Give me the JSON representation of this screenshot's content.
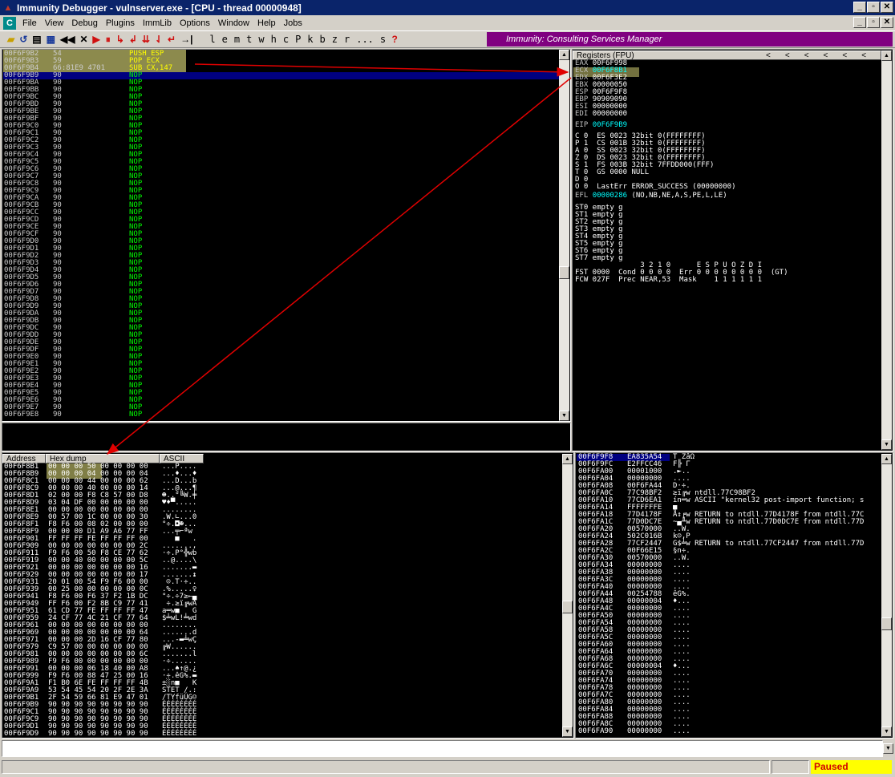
{
  "window": {
    "title": "Immunity Debugger - vulnserver.exe - [CPU - thread 00000948]",
    "min": "_",
    "restore": "▫",
    "close": "✕"
  },
  "menu": [
    "File",
    "View",
    "Debug",
    "Plugins",
    "ImmLib",
    "Options",
    "Window",
    "Help",
    "Jobs"
  ],
  "toolbar": {
    "buttons": [
      "◀◀",
      "✕",
      "▶",
      "⏸",
      "↳",
      "↲",
      "⇊",
      "⇃",
      "↵",
      "→|"
    ],
    "letters": [
      "l",
      "e",
      "m",
      "t",
      "w",
      "h",
      "c",
      "P",
      "k",
      "b",
      "z",
      "r",
      "...",
      "s",
      "?"
    ],
    "banner": "Immunity: Consulting Services Manager"
  },
  "disasm": [
    {
      "addr": "00F6F9B2",
      "hex": "54",
      "ins": "PUSH ESP"
    },
    {
      "addr": "00F6F9B3",
      "hex": "59",
      "ins": "POP ECX"
    },
    {
      "addr": "00F6F9B4",
      "hex": "66:81E9 4701",
      "ins": "SUB CX,147"
    },
    {
      "addr": "00F6F9B9",
      "hex": "90",
      "ins": "NOP"
    },
    {
      "addr": "00F6F9BA",
      "hex": "90",
      "ins": "NOP"
    },
    {
      "addr": "00F6F9BB",
      "hex": "90",
      "ins": "NOP"
    },
    {
      "addr": "00F6F9BC",
      "hex": "90",
      "ins": "NOP"
    },
    {
      "addr": "00F6F9BD",
      "hex": "90",
      "ins": "NOP"
    },
    {
      "addr": "00F6F9BE",
      "hex": "90",
      "ins": "NOP"
    },
    {
      "addr": "00F6F9BF",
      "hex": "90",
      "ins": "NOP"
    },
    {
      "addr": "00F6F9C0",
      "hex": "90",
      "ins": "NOP"
    },
    {
      "addr": "00F6F9C1",
      "hex": "90",
      "ins": "NOP"
    },
    {
      "addr": "00F6F9C2",
      "hex": "90",
      "ins": "NOP"
    },
    {
      "addr": "00F6F9C3",
      "hex": "90",
      "ins": "NOP"
    },
    {
      "addr": "00F6F9C4",
      "hex": "90",
      "ins": "NOP"
    },
    {
      "addr": "00F6F9C5",
      "hex": "90",
      "ins": "NOP"
    },
    {
      "addr": "00F6F9C6",
      "hex": "90",
      "ins": "NOP"
    },
    {
      "addr": "00F6F9C7",
      "hex": "90",
      "ins": "NOP"
    },
    {
      "addr": "00F6F9C8",
      "hex": "90",
      "ins": "NOP"
    },
    {
      "addr": "00F6F9C9",
      "hex": "90",
      "ins": "NOP"
    },
    {
      "addr": "00F6F9CA",
      "hex": "90",
      "ins": "NOP"
    },
    {
      "addr": "00F6F9CB",
      "hex": "90",
      "ins": "NOP"
    },
    {
      "addr": "00F6F9CC",
      "hex": "90",
      "ins": "NOP"
    },
    {
      "addr": "00F6F9CD",
      "hex": "90",
      "ins": "NOP"
    },
    {
      "addr": "00F6F9CE",
      "hex": "90",
      "ins": "NOP"
    },
    {
      "addr": "00F6F9CF",
      "hex": "90",
      "ins": "NOP"
    },
    {
      "addr": "00F6F9D0",
      "hex": "90",
      "ins": "NOP"
    },
    {
      "addr": "00F6F9D1",
      "hex": "90",
      "ins": "NOP"
    },
    {
      "addr": "00F6F9D2",
      "hex": "90",
      "ins": "NOP"
    },
    {
      "addr": "00F6F9D3",
      "hex": "90",
      "ins": "NOP"
    },
    {
      "addr": "00F6F9D4",
      "hex": "90",
      "ins": "NOP"
    },
    {
      "addr": "00F6F9D5",
      "hex": "90",
      "ins": "NOP"
    },
    {
      "addr": "00F6F9D6",
      "hex": "90",
      "ins": "NOP"
    },
    {
      "addr": "00F6F9D7",
      "hex": "90",
      "ins": "NOP"
    },
    {
      "addr": "00F6F9D8",
      "hex": "90",
      "ins": "NOP"
    },
    {
      "addr": "00F6F9D9",
      "hex": "90",
      "ins": "NOP"
    },
    {
      "addr": "00F6F9DA",
      "hex": "90",
      "ins": "NOP"
    },
    {
      "addr": "00F6F9DB",
      "hex": "90",
      "ins": "NOP"
    },
    {
      "addr": "00F6F9DC",
      "hex": "90",
      "ins": "NOP"
    },
    {
      "addr": "00F6F9DD",
      "hex": "90",
      "ins": "NOP"
    },
    {
      "addr": "00F6F9DE",
      "hex": "90",
      "ins": "NOP"
    },
    {
      "addr": "00F6F9DF",
      "hex": "90",
      "ins": "NOP"
    },
    {
      "addr": "00F6F9E0",
      "hex": "90",
      "ins": "NOP"
    },
    {
      "addr": "00F6F9E1",
      "hex": "90",
      "ins": "NOP"
    },
    {
      "addr": "00F6F9E2",
      "hex": "90",
      "ins": "NOP"
    },
    {
      "addr": "00F6F9E3",
      "hex": "90",
      "ins": "NOP"
    },
    {
      "addr": "00F6F9E4",
      "hex": "90",
      "ins": "NOP"
    },
    {
      "addr": "00F6F9E5",
      "hex": "90",
      "ins": "NOP"
    },
    {
      "addr": "00F6F9E6",
      "hex": "90",
      "ins": "NOP"
    },
    {
      "addr": "00F6F9E7",
      "hex": "90",
      "ins": "NOP"
    },
    {
      "addr": "00F6F9E8",
      "hex": "90",
      "ins": "NOP"
    }
  ],
  "registers": {
    "header": "Registers (FPU)",
    "gp": [
      {
        "name": "EAX",
        "val": "00F6F998"
      },
      {
        "name": "ECX",
        "val": "00F6F8B1"
      },
      {
        "name": "EDX",
        "val": "00F6F3E2"
      },
      {
        "name": "EBX",
        "val": "00000050"
      },
      {
        "name": "ESP",
        "val": "00F6F9F8"
      },
      {
        "name": "EBP",
        "val": "90909090"
      },
      {
        "name": "ESI",
        "val": "00000000"
      },
      {
        "name": "EDI",
        "val": "00000000"
      }
    ],
    "eip": {
      "name": "EIP",
      "val": "00F6F9B9"
    },
    "flags": [
      "C 0  ES 0023 32bit 0(FFFFFFFF)",
      "P 1  CS 001B 32bit 0(FFFFFFFF)",
      "A 0  SS 0023 32bit 0(FFFFFFFF)",
      "Z 0  DS 0023 32bit 0(FFFFFFFF)",
      "S 1  FS 003B 32bit 7FFDD000(FFF)",
      "T 0  GS 0000 NULL",
      "D 0",
      "O 0  LastErr ERROR_SUCCESS (00000000)"
    ],
    "efl": {
      "name": "EFL",
      "val": "00000286",
      "desc": "(NO,NB,NE,A,S,PE,L,LE)"
    },
    "fpu": [
      "ST0 empty g",
      "ST1 empty g",
      "ST2 empty g",
      "ST3 empty g",
      "ST4 empty g",
      "ST5 empty g",
      "ST6 empty g",
      "ST7 empty g"
    ],
    "fst_hdr": "               3 2 1 0      E S P U O Z D I",
    "fst": "FST 0000  Cond 0 0 0 0  Err 0 0 0 0 0 0 0 0  (GT)",
    "fcw": "FCW 027F  Prec NEAR,53  Mask    1 1 1 1 1 1",
    "nav_arrows": [
      "<",
      "<",
      "<",
      "<",
      "<",
      "<",
      "<",
      "<",
      "<"
    ]
  },
  "dump": {
    "col_address": "Address",
    "col_hex": "Hex dump",
    "col_ascii": "ASCII",
    "rows": [
      {
        "a": "00F6F8B1",
        "h": "00 00 00 50 00 00 00 00",
        "s": "...P...."
      },
      {
        "a": "00F6F8B9",
        "h": "00 00 00 04 00 00 00 04",
        "s": "...♦...♦"
      },
      {
        "a": "00F6F8C1",
        "h": "00 00 00 44 00 00 00 62",
        "s": "...D...b"
      },
      {
        "a": "00F6F8C9",
        "h": "00 00 00 40 00 00 00 14",
        "s": "...@...¶"
      },
      {
        "a": "00F6F8D1",
        "h": "02 00 00 F8 C8 57 00 D8",
        "s": "☻..°╚W.╪"
      },
      {
        "a": "00F6F8D9",
        "h": "03 04 DF 00 00 00 00 00",
        "s": "♥♦▀....."
      },
      {
        "a": "00F6F8E1",
        "h": "00 00 00 00 00 00 00 00",
        "s": "........"
      },
      {
        "a": "00F6F8E9",
        "h": "00 57 00 1C 00 00 00 30",
        "s": ".W.∟...0"
      },
      {
        "a": "00F6F8F1",
        "h": "F8 F6 00 08 02 00 00 00",
        "s": "°÷.◘☻..."
      },
      {
        "a": "00F6F8F9",
        "h": "00 00 00 D1 A9 A6 77 FF",
        "s": "...╤⌐ªw "
      },
      {
        "a": "00F6F901",
        "h": "FF FF FF FE FF FF FF 00",
        "s": "   ■   ."
      },
      {
        "a": "00F6F909",
        "h": "00 00 00 00 00 00 00 2C",
        "s": ".......,"
      },
      {
        "a": "00F6F911",
        "h": "F9 F6 00 50 F8 CE 77 62",
        "s": "·÷.P°╬wb"
      },
      {
        "a": "00F6F919",
        "h": "00 00 40 00 00 00 00 5C",
        "s": "..@....\\"
      },
      {
        "a": "00F6F921",
        "h": "00 00 00 00 00 00 00 16",
        "s": ".......▬"
      },
      {
        "a": "00F6F929",
        "h": "00 00 00 00 00 00 00 17",
        "s": ".......↨"
      },
      {
        "a": "00F6F931",
        "h": "20 01 00 54 F9 F6 00 00",
        "s": " ☺.T·÷.."
      },
      {
        "a": "00F6F939",
        "h": "00 25 00 00 00 00 00 0C",
        "s": ".%.....♀"
      },
      {
        "a": "00F6F941",
        "h": "F8 F6 00 F6 37 F2 1B DC",
        "s": "°÷.÷7≥←▄"
      },
      {
        "a": "00F6F949",
        "h": "FF F6 00 F2 8B C9 77 41",
        "s": " ÷.≥ï╔wA"
      },
      {
        "a": "00F6F951",
        "h": "61 CD 77 FE FF FF FF 47",
        "s": "a═w■   G"
      },
      {
        "a": "00F6F959",
        "h": "24 CF 77 4C 21 CF 77 64",
        "s": "$╧wL!╧wd"
      },
      {
        "a": "00F6F961",
        "h": "00 00 00 00 00 00 00 00",
        "s": "........"
      },
      {
        "a": "00F6F969",
        "h": "00 00 00 00 00 00 00 64",
        "s": ".......d"
      },
      {
        "a": "00F6F971",
        "h": "00 00 00 2D 16 CF 77 80",
        "s": "...-▬╧wÇ"
      },
      {
        "a": "00F6F979",
        "h": "C9 57 00 00 00 00 00 00",
        "s": "╔W......"
      },
      {
        "a": "00F6F981",
        "h": "00 00 00 00 00 00 00 6C",
        "s": ".......l"
      },
      {
        "a": "00F6F989",
        "h": "F9 F6 00 00 00 00 00 00",
        "s": "·÷......"
      },
      {
        "a": "00F6F991",
        "h": "00 00 00 06 18 40 00 A8",
        "s": "...♠↑@.¿"
      },
      {
        "a": "00F6F999",
        "h": "F9 F6 00 88 47 25 00 16",
        "s": "·÷.êG%.▬"
      },
      {
        "a": "00F6F9A1",
        "h": "F1 B0 6E FE FF FF FF 4B",
        "s": "±░n■   K"
      },
      {
        "a": "00F6F9A9",
        "h": "53 54 45 54 20 2F 2E 3A",
        "s": "STET /.:"
      },
      {
        "a": "00F6F9B1",
        "h": "2F 54 59 66 81 E9 47 01",
        "s": "/TYfüÚG☺"
      },
      {
        "a": "00F6F9B9",
        "h": "90 90 90 90 90 90 90 90",
        "s": "ÉÉÉÉÉÉÉÉ"
      },
      {
        "a": "00F6F9C1",
        "h": "90 90 90 90 90 90 90 90",
        "s": "ÉÉÉÉÉÉÉÉ"
      },
      {
        "a": "00F6F9C9",
        "h": "90 90 90 90 90 90 90 90",
        "s": "ÉÉÉÉÉÉÉÉ"
      },
      {
        "a": "00F6F9D1",
        "h": "90 90 90 90 90 90 90 90",
        "s": "ÉÉÉÉÉÉÉÉ"
      },
      {
        "a": "00F6F9D9",
        "h": "90 90 90 90 90 90 90 90",
        "s": "ÉÉÉÉÉÉÉÉ"
      }
    ]
  },
  "stack": [
    {
      "a": "00F6F9F8",
      "v": "EA835A54",
      "c": "T ZâΩ"
    },
    {
      "a": "00F6F9FC",
      "v": "E2FFCC46",
      "c": "F╠ Γ"
    },
    {
      "a": "00F6FA00",
      "v": "00001000",
      "c": ".►.."
    },
    {
      "a": "00F6FA04",
      "v": "00000000",
      "c": "...."
    },
    {
      "a": "00F6FA08",
      "v": "00F6FA44",
      "c": "D·÷."
    },
    {
      "a": "00F6FA0C",
      "v": "77C98BF2",
      "c": "≥ï╔w ntdll.77C98BF2"
    },
    {
      "a": "00F6FA10",
      "v": "77CD6EA1",
      "c": "ín═w ASCII \"kernel32 post-import function; s"
    },
    {
      "a": "00F6FA14",
      "v": "FFFFFFFE",
      "c": "■"
    },
    {
      "a": "00F6FA18",
      "v": "77D4178F",
      "c": "Å↕╒w RETURN to ntdll.77D4178F from ntdll.77C"
    },
    {
      "a": "00F6FA1C",
      "v": "77D0DC7E",
      "c": "~▄╨w RETURN to ntdll.77D0DC7E from ntdll.77D"
    },
    {
      "a": "00F6FA20",
      "v": "00570000",
      "c": "..W."
    },
    {
      "a": "00F6FA24",
      "v": "502C016B",
      "c": "k☺,P"
    },
    {
      "a": "00F6FA28",
      "v": "77CF2447",
      "c": "G$╧w RETURN to ntdll.77CF2447 from ntdll.77D"
    },
    {
      "a": "00F6FA2C",
      "v": "00F66E15",
      "c": "§n÷."
    },
    {
      "a": "00F6FA30",
      "v": "00570000",
      "c": "..W."
    },
    {
      "a": "00F6FA34",
      "v": "00000000",
      "c": "...."
    },
    {
      "a": "00F6FA38",
      "v": "00000000",
      "c": "...."
    },
    {
      "a": "00F6FA3C",
      "v": "00000000",
      "c": "...."
    },
    {
      "a": "00F6FA40",
      "v": "00000000",
      "c": "...."
    },
    {
      "a": "00F6FA44",
      "v": "00254788",
      "c": "êG%."
    },
    {
      "a": "00F6FA48",
      "v": "00000004",
      "c": "♦..."
    },
    {
      "a": "00F6FA4C",
      "v": "00000000",
      "c": "...."
    },
    {
      "a": "00F6FA50",
      "v": "00000000",
      "c": "...."
    },
    {
      "a": "00F6FA54",
      "v": "00000000",
      "c": "...."
    },
    {
      "a": "00F6FA58",
      "v": "00000000",
      "c": "...."
    },
    {
      "a": "00F6FA5C",
      "v": "00000000",
      "c": "...."
    },
    {
      "a": "00F6FA60",
      "v": "00000000",
      "c": "...."
    },
    {
      "a": "00F6FA64",
      "v": "00000000",
      "c": "...."
    },
    {
      "a": "00F6FA68",
      "v": "00000000",
      "c": "...."
    },
    {
      "a": "00F6FA6C",
      "v": "00000004",
      "c": "♦..."
    },
    {
      "a": "00F6FA70",
      "v": "00000000",
      "c": "...."
    },
    {
      "a": "00F6FA74",
      "v": "00000000",
      "c": "...."
    },
    {
      "a": "00F6FA78",
      "v": "00000000",
      "c": "...."
    },
    {
      "a": "00F6FA7C",
      "v": "00000000",
      "c": "...."
    },
    {
      "a": "00F6FA80",
      "v": "00000000",
      "c": "...."
    },
    {
      "a": "00F6FA84",
      "v": "00000000",
      "c": "...."
    },
    {
      "a": "00F6FA88",
      "v": "00000000",
      "c": "...."
    },
    {
      "a": "00F6FA8C",
      "v": "00000000",
      "c": "...."
    },
    {
      "a": "00F6FA90",
      "v": "00000000",
      "c": "...."
    }
  ],
  "status": {
    "state": "Paused"
  },
  "colors": {
    "banner": "#800080",
    "highlight": "#fffb8c",
    "arrow": "#e00000",
    "selected_row": "#000080"
  }
}
